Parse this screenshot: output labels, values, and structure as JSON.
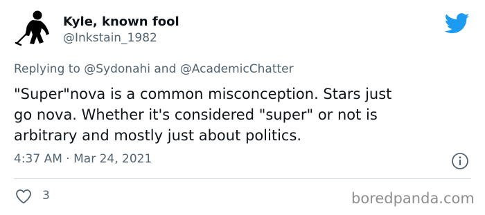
{
  "user": {
    "display_name": "Kyle, known fool",
    "handle": "@Inkstain_1982"
  },
  "reply": {
    "prefix": "Replying to",
    "mention_1": "@Sydonahi",
    "connector": "and",
    "mention_2": "@AcademicChatter"
  },
  "tweet": {
    "text": "\"Super\"nova is a common misconception. Stars just\ngo nova.  Whether it's considered \"super\" or not is\narbitrary and mostly just about politics.",
    "time": "4:37 AM",
    "separator": "·",
    "date": "Mar 24, 2021"
  },
  "stats": {
    "likes": "3"
  },
  "watermark": "boredpanda.com",
  "icons": {
    "avatar": "hockey-player-silhouette",
    "brand": "twitter-bird-icon",
    "info": "info-icon",
    "like": "heart-icon"
  },
  "colors": {
    "twitter_blue": "#1d9bf0",
    "secondary_text": "#536471",
    "primary_text": "#0f1419"
  }
}
